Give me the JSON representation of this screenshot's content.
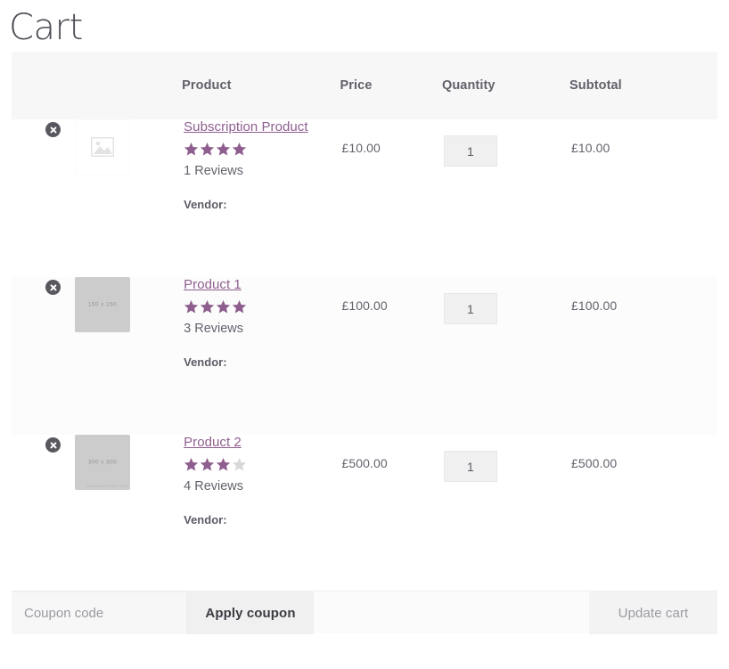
{
  "page": {
    "title": "Cart"
  },
  "colors": {
    "link": "#8e5f8e",
    "star_filled": "#8e5f8e",
    "star_empty": "#d8d8d8",
    "header_bg": "#f7f7f7",
    "text": "#63636d"
  },
  "table": {
    "headers": {
      "remove": "",
      "thumbnail": "",
      "product": "Product",
      "price": "Price",
      "quantity": "Quantity",
      "subtotal": "Subtotal"
    },
    "rows": [
      {
        "remove_icon": "remove-circle-x-icon",
        "thumbnail": {
          "type": "placeholder",
          "icon": "image-placeholder-icon",
          "dimensions": "",
          "credit": ""
        },
        "name": "Subscription Product",
        "rating": 4,
        "rating_max": 4,
        "stars_filled": 4,
        "stars_empty": 0,
        "reviews": "1 Reviews",
        "vendor_label": "Vendor:",
        "vendor_value": "",
        "price": "£10.00",
        "quantity": "1",
        "subtotal": "£10.00"
      },
      {
        "remove_icon": "remove-circle-x-icon",
        "thumbnail": {
          "type": "image",
          "icon": "",
          "dimensions": "150 x 150",
          "credit": ""
        },
        "name": "Product 1",
        "rating": 4,
        "rating_max": 4,
        "stars_filled": 4,
        "stars_empty": 0,
        "reviews": "3 Reviews",
        "vendor_label": "Vendor:",
        "vendor_value": "",
        "price": "£100.00",
        "quantity": "1",
        "subtotal": "£100.00"
      },
      {
        "remove_icon": "remove-circle-x-icon",
        "thumbnail": {
          "type": "image",
          "icon": "",
          "dimensions": "300 x 300",
          "credit": "Powered by HTML.COM"
        },
        "name": "Product 2",
        "rating": 3,
        "rating_max": 4,
        "stars_filled": 3,
        "stars_empty": 1,
        "reviews": "4 Reviews",
        "vendor_label": "Vendor:",
        "vendor_value": "",
        "price": "£500.00",
        "quantity": "1",
        "subtotal": "£500.00"
      }
    ]
  },
  "actions": {
    "coupon_placeholder": "Coupon code",
    "coupon_value": "",
    "apply_label": "Apply coupon",
    "update_label": "Update cart",
    "update_disabled": true
  }
}
